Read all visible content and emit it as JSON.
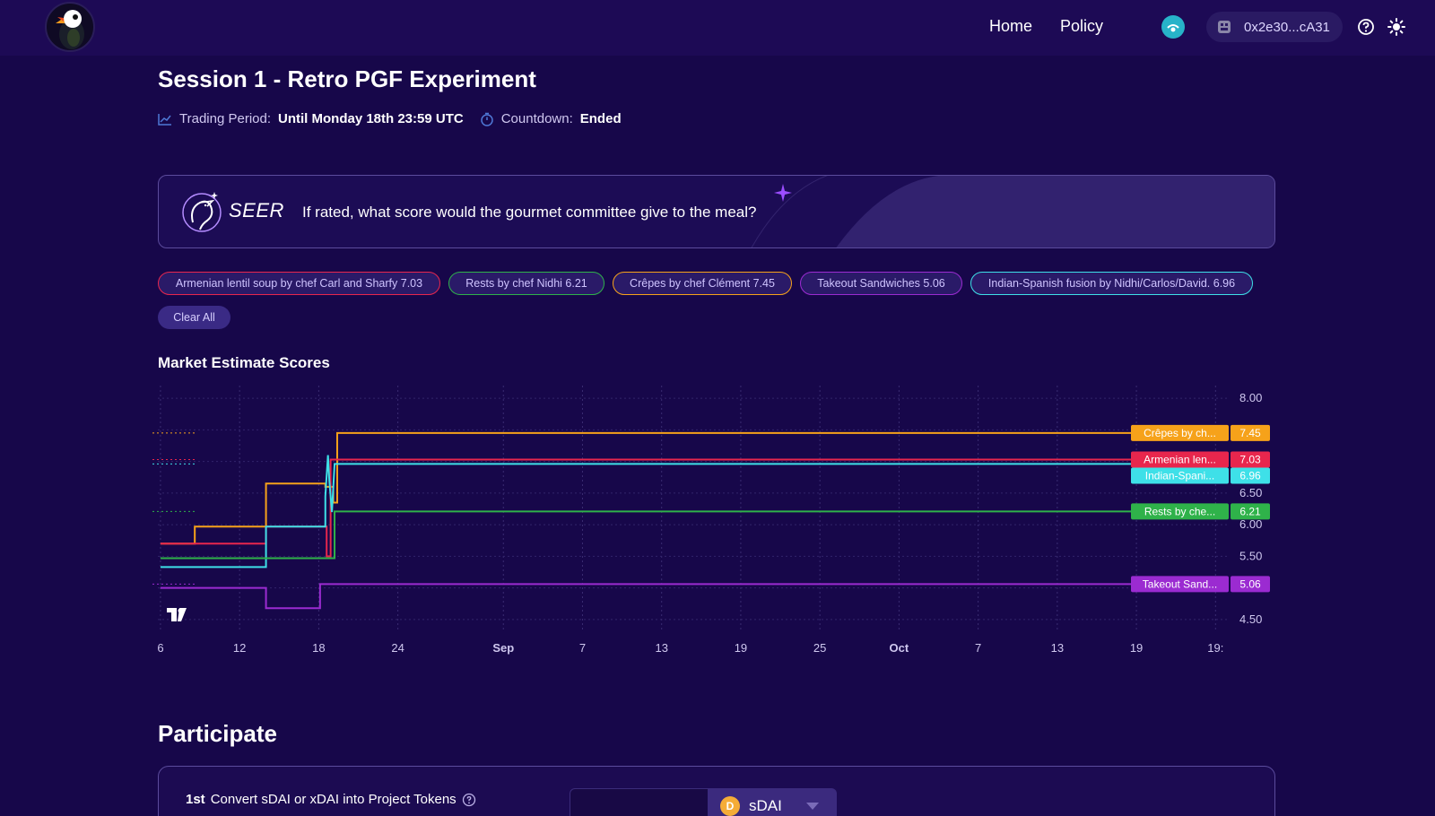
{
  "nav": {
    "home_label": "Home",
    "policy_label": "Policy",
    "wallet_address": "0x2e30...cA31"
  },
  "header": {
    "title": "Session 1 - Retro PGF Experiment",
    "trading_period_label": "Trading Period:",
    "trading_period_value": "Until Monday 18th 23:59 UTC",
    "countdown_label": "Countdown:",
    "countdown_value": "Ended"
  },
  "question": {
    "brand": "SEER",
    "text": "If rated, what score would the gourmet committee give to the meal?"
  },
  "outcomes": [
    {
      "label": "Armenian lentil soup by chef Carl and Sharfy 7.03",
      "color": "#e8264d"
    },
    {
      "label": "Rests by chef Nidhi 6.21",
      "color": "#2fb24a"
    },
    {
      "label": "Crêpes by chef Clément 7.45",
      "color": "#f6a21a"
    },
    {
      "label": "Takeout Sandwiches 5.06",
      "color": "#9b2bd1"
    },
    {
      "label": "Indian-Spanish fusion by Nidhi/Carlos/David. 6.96",
      "color": "#3ee0e8"
    }
  ],
  "clear_all_label": "Clear All",
  "chart_section_title": "Market Estimate Scores",
  "chart_data": {
    "type": "line",
    "title": "",
    "x_tick_labels": [
      "6",
      "12",
      "18",
      "24",
      "Sep",
      "7",
      "13",
      "19",
      "25",
      "Oct",
      "7",
      "13",
      "19",
      "19:"
    ],
    "x_tick_days": [
      6,
      12,
      18,
      24,
      32,
      38,
      44,
      50,
      56,
      62,
      68,
      74,
      80,
      86
    ],
    "y_tick_labels": [
      "8.00",
      "6.50",
      "6.00",
      "5.50",
      "4.50"
    ],
    "y_ticks": [
      8.0,
      6.5,
      6.0,
      5.5,
      4.5
    ],
    "ylim": [
      4.3,
      8.2
    ],
    "x_unit_note": "days since Aug 1",
    "grid": true,
    "series": [
      {
        "name": "Crêpes by ch...",
        "color": "#f6a21a",
        "final": "7.45",
        "x": [
          6,
          8.6,
          8.6,
          14,
          14,
          18.5,
          18.5,
          19.1,
          19.1,
          19.4,
          19.4,
          20,
          86
        ],
        "y": [
          5.7,
          5.7,
          5.97,
          5.97,
          6.65,
          6.65,
          6.6,
          6.6,
          6.35,
          6.35,
          7.45,
          7.45,
          7.45
        ]
      },
      {
        "name": "Armenian len...",
        "color": "#e8264d",
        "final": "7.03",
        "x": [
          6,
          14,
          14,
          18.6,
          18.6,
          18.9,
          18.9,
          19.5,
          19.5,
          86
        ],
        "y": [
          5.7,
          5.7,
          5.97,
          5.97,
          5.5,
          5.5,
          7.03,
          7.03,
          7.03,
          7.03
        ]
      },
      {
        "name": "Indian-Spani...",
        "color": "#3ee0e8",
        "final": "6.96",
        "x": [
          6,
          14,
          14,
          18.5,
          18.5,
          18.7,
          18.8,
          19.0,
          19.2,
          19.5,
          19.5,
          86
        ],
        "y": [
          5.33,
          5.33,
          5.97,
          5.97,
          6.45,
          7.1,
          6.7,
          6.2,
          6.96,
          6.96,
          6.96,
          6.96
        ]
      },
      {
        "name": "Rests by che...",
        "color": "#2fb24a",
        "final": "6.21",
        "x": [
          6,
          19.2,
          19.2,
          86
        ],
        "y": [
          5.47,
          5.47,
          6.21,
          6.21
        ]
      },
      {
        "name": "Takeout Sand...",
        "color": "#9b2bd1",
        "final": "5.06",
        "x": [
          6,
          14,
          14,
          18.1,
          18.1,
          86
        ],
        "y": [
          5.0,
          5.0,
          4.68,
          4.68,
          5.06,
          5.06
        ]
      }
    ]
  },
  "participate": {
    "title": "Participate",
    "step_num": "1st",
    "step_text": "Convert sDAI or xDAI into Project Tokens",
    "token": "sDAI"
  }
}
